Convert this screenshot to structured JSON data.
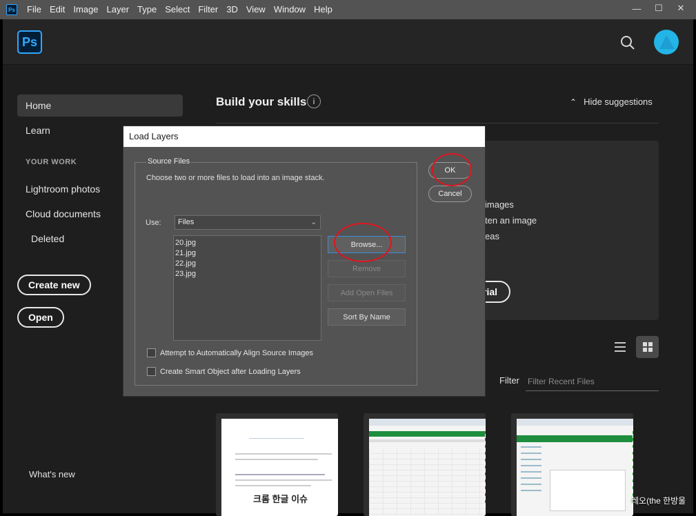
{
  "menubar": {
    "app_icon": "Ps",
    "items": [
      "File",
      "Edit",
      "Image",
      "Layer",
      "Type",
      "Select",
      "Filter",
      "3D",
      "View",
      "Window",
      "Help"
    ],
    "window_controls": [
      "—",
      "☐",
      "✕"
    ]
  },
  "header": {
    "logo": "Ps"
  },
  "sidebar": {
    "home": "Home",
    "learn": "Learn",
    "your_work_heading": "YOUR WORK",
    "lightroom": "Lightroom photos",
    "cloud_docs": "Cloud documents",
    "deleted": "Deleted",
    "create_new": "Create new",
    "open": "Open",
    "whats_new": "What's new"
  },
  "main": {
    "skills_title": "Build your skills",
    "info_glyph": "i",
    "hide_suggestions": "Hide suggestions",
    "suggestion_lines": [
      "images",
      "ten an image",
      "eas"
    ],
    "tutorial_button_partial": "rial",
    "filter_label": "Filter",
    "filter_placeholder": "Filter Recent Files"
  },
  "dialog": {
    "title": "Load Layers",
    "source_files_legend": "Source Files",
    "instruction": "Choose two or more files to load into an image stack.",
    "use_label": "Use:",
    "use_value": "Files",
    "files": [
      "20.jpg",
      "21.jpg",
      "22.jpg",
      "23.jpg"
    ],
    "browse": "Browse...",
    "remove": "Remove",
    "add_open_files": "Add Open Files",
    "sort_by_name": "Sort By Name",
    "align_checkbox": "Attempt to Automatically Align Source Images",
    "smart_object_checkbox": "Create Smart Object after Loading Layers",
    "ok": "OK",
    "cancel": "Cancel"
  },
  "thumbnails": {
    "first_caption": "크롬 한글 이슈"
  },
  "watermark": "레오(the 한방울",
  "colors": {
    "accent_blue": "#31a8ff",
    "annotation_red": "#e0141e",
    "avatar": "#23b5e8"
  }
}
